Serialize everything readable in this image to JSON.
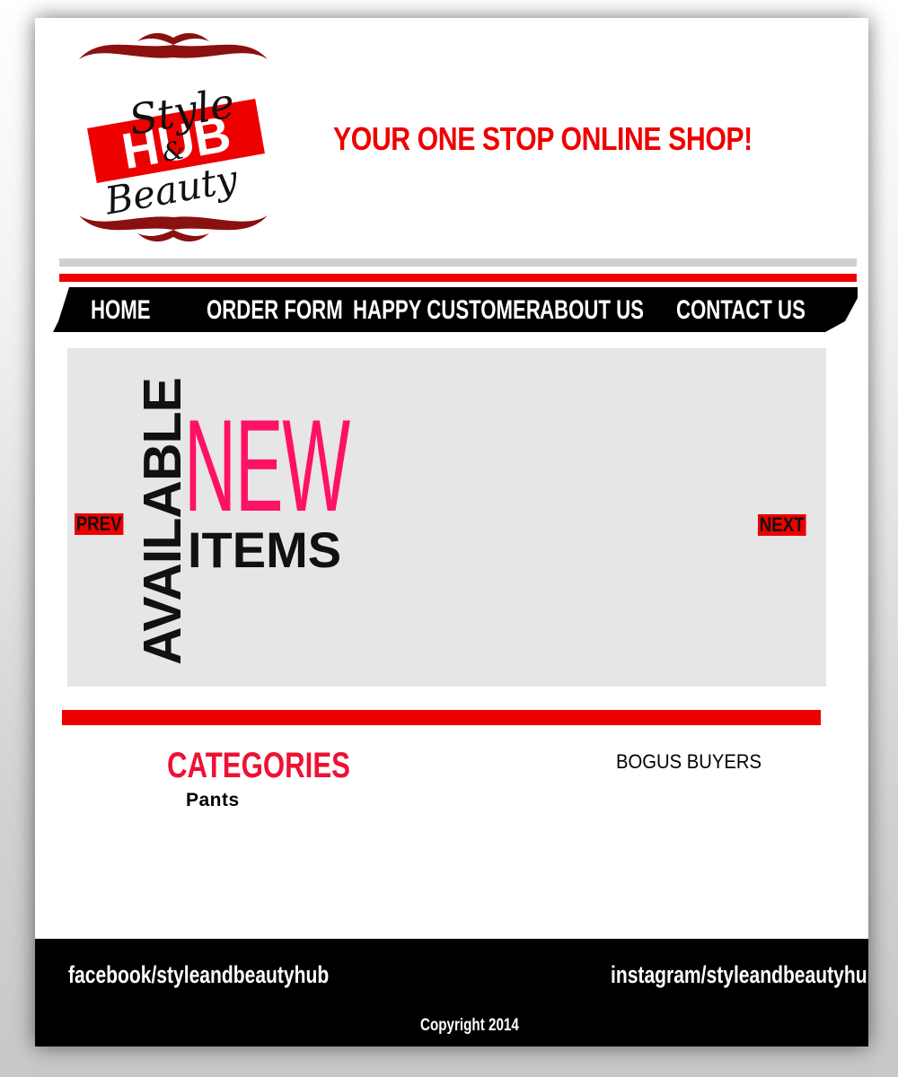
{
  "logo": {
    "line1": "Style",
    "line2": "&",
    "line3": "Beauty",
    "stamp": "HUB"
  },
  "header": {
    "tagline": "YOUR ONE STOP ONLINE SHOP!"
  },
  "nav": {
    "items": [
      {
        "label": "HOME"
      },
      {
        "label": "ORDER FORM"
      },
      {
        "label": "HAPPY CUSTOMER"
      },
      {
        "label": "ABOUT US"
      },
      {
        "label": "CONTACT US"
      }
    ]
  },
  "slider": {
    "prev_label": "PREV",
    "next_label": "NEXT",
    "banner": {
      "word_vertical": "AVAILABLE",
      "word_big": "NEW",
      "word_small": "ITEMS"
    }
  },
  "categories": {
    "title": "CATEGORIES",
    "items": [
      "Pants"
    ]
  },
  "sidebar": {
    "heading": "BOGUS BUYERS"
  },
  "footer": {
    "facebook": "facebook/styleandbeautyhub",
    "instagram": "instagram/styleandbeautyhub",
    "copyright": "Copyright 2014"
  },
  "colors": {
    "accent_red": "#ee0000",
    "new_pink": "#ff1166",
    "nav_bg": "#000000",
    "slider_bg": "#e6e6e6"
  }
}
